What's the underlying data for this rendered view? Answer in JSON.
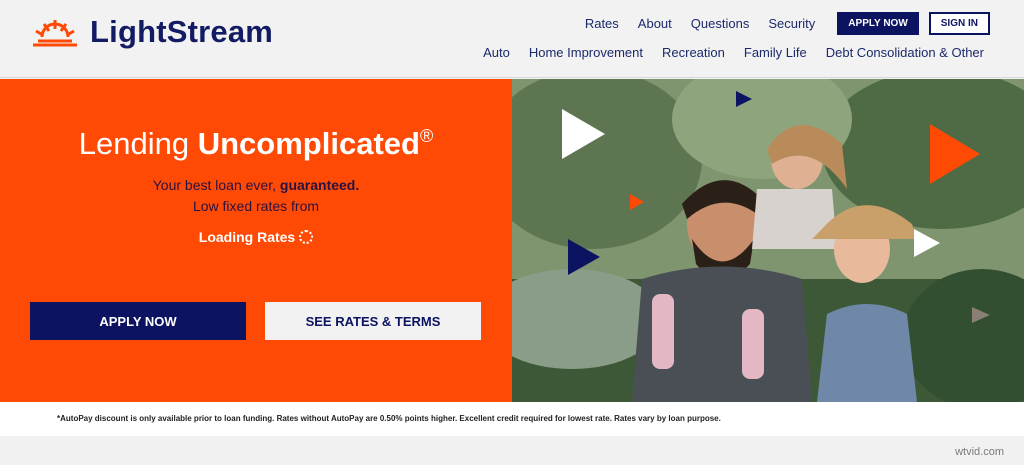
{
  "header": {
    "brand": "LightStream",
    "topnav": [
      "Rates",
      "About",
      "Questions",
      "Security"
    ],
    "apply_label": "APPLY NOW",
    "signin_label": "SIGN IN",
    "subnav": [
      "Auto",
      "Home Improvement",
      "Recreation",
      "Family Life",
      "Debt Consolidation & Other"
    ]
  },
  "hero": {
    "headline_light": "Lending ",
    "headline_bold": "Uncomplicated",
    "headline_mark": "®",
    "line1_prefix": "Your best loan ever, ",
    "line1_bold": "guaranteed.",
    "line2": "Low fixed rates from",
    "loading": "Loading Rates",
    "apply_button": "APPLY NOW",
    "rates_button": "SEE RATES & TERMS"
  },
  "footer": {
    "disclaimer": "*AutoPay discount is only available prior to loan funding. Rates without AutoPay are 0.50% points higher. Excellent credit required for lowest rate. Rates vary by loan purpose."
  },
  "watermark": "wtvid.com",
  "colors": {
    "brand_navy": "#0c1462",
    "brand_orange": "#ff4a05"
  }
}
